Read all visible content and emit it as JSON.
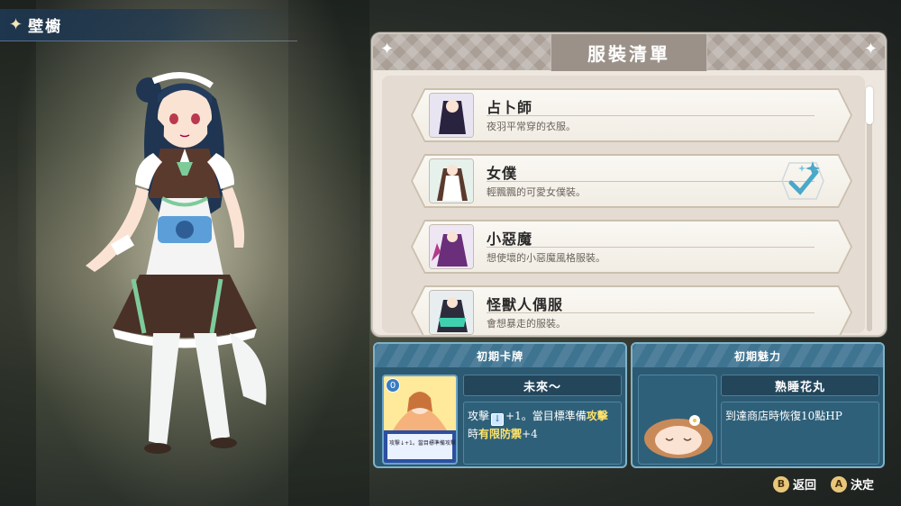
{
  "header": {
    "location_label": "壁櫥"
  },
  "outfit_panel": {
    "title": "服裝清單",
    "items": [
      {
        "name": "占卜師",
        "desc": "夜羽平常穿的衣服。",
        "equipped": false
      },
      {
        "name": "女僕",
        "desc": "輕飄飄的可愛女僕裝。",
        "equipped": true
      },
      {
        "name": "小惡魔",
        "desc": "想使壞的小惡魔風格服裝。",
        "equipped": false
      },
      {
        "name": "怪獸人偶服",
        "desc": "會想暴走的服裝。",
        "equipped": false
      }
    ]
  },
  "initial_card": {
    "header": "初期卡牌",
    "card_name": "未來～",
    "desc_parts": {
      "a": "攻擊",
      "b": "+1。當目標準備",
      "c": "攻擊",
      "d": "時",
      "e": "有限防禦",
      "f": "+4"
    },
    "cost": "0",
    "card_text": "攻擊↓+1。當目標準備攻擊時有限防禦+4"
  },
  "initial_charm": {
    "header": "初期魅力",
    "name": "熟睡花丸",
    "desc": "到達商店時恢復10點HP"
  },
  "controls": {
    "back": {
      "key": "B",
      "label": "返回"
    },
    "confirm": {
      "key": "A",
      "label": "決定"
    }
  },
  "colors": {
    "accent_gold": "#e8c77a",
    "panel_blue": "#2c5a73",
    "highlight": "#ffe36a"
  }
}
